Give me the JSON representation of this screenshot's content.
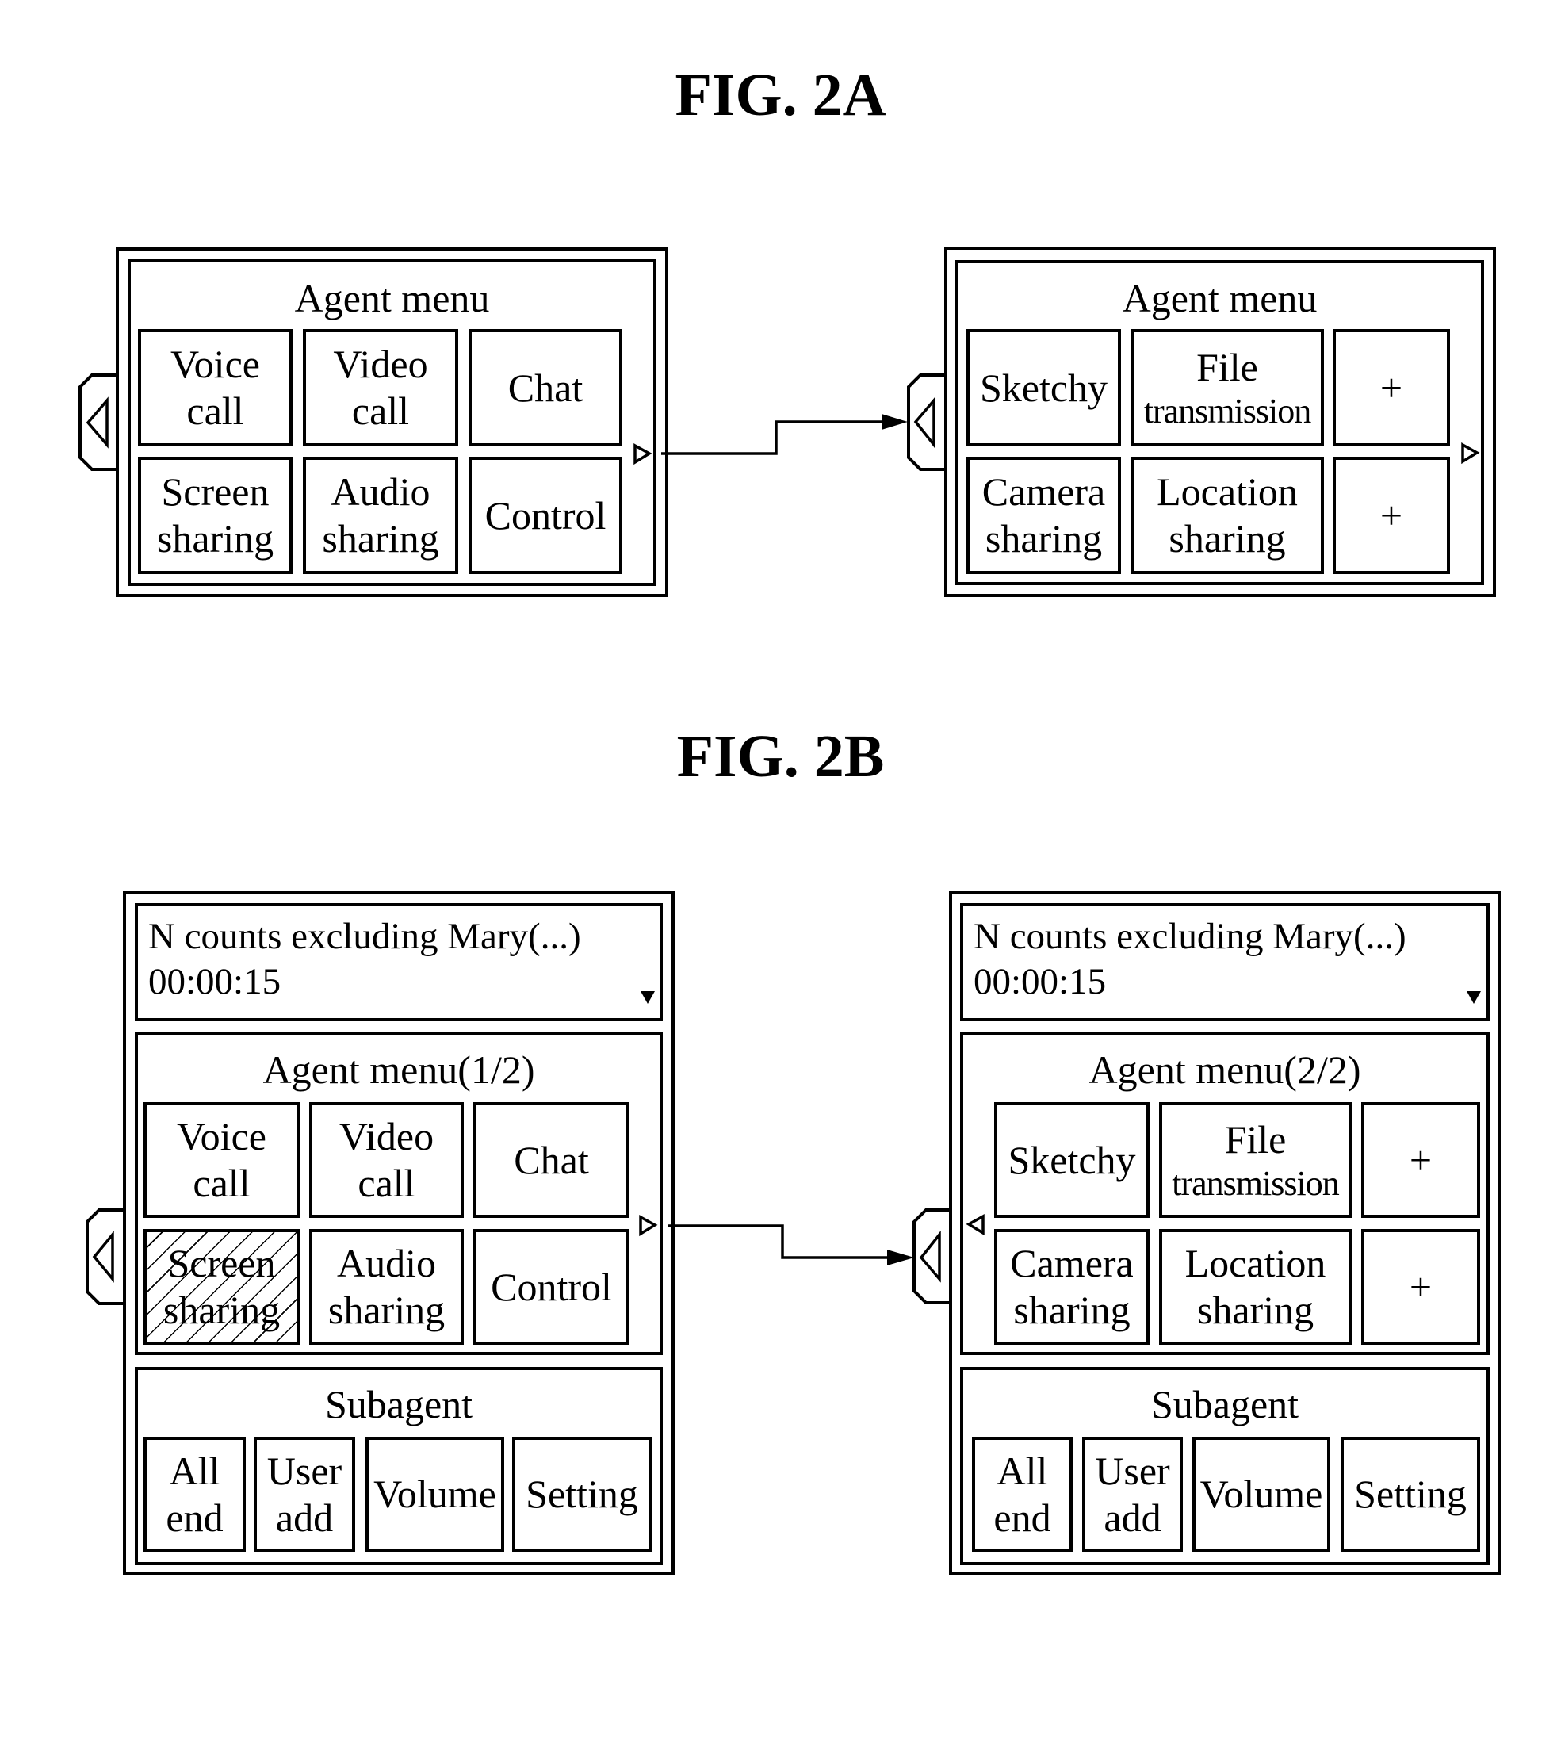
{
  "figures": {
    "fig2a": {
      "title": "FIG. 2A",
      "left_panel": {
        "section_title": "Agent menu",
        "items": [
          [
            "Voice",
            "call"
          ],
          [
            "Video",
            "call"
          ],
          [
            "Chat"
          ],
          [
            "Screen",
            "sharing"
          ],
          [
            "Audio",
            "sharing"
          ],
          [
            "Control"
          ]
        ]
      },
      "right_panel": {
        "section_title": "Agent menu",
        "items": [
          [
            "Sketchy"
          ],
          [
            "File",
            "transmission"
          ],
          [
            "+"
          ],
          [
            "Camera",
            "sharing"
          ],
          [
            "Location",
            "sharing"
          ],
          [
            "+"
          ]
        ]
      }
    },
    "fig2b": {
      "title": "FIG. 2B",
      "left_panel": {
        "header_line1": "N counts excluding Mary(...)",
        "header_line2": "00:00:15",
        "agent_title": "Agent menu(1/2)",
        "agent_items": [
          [
            "Voice",
            "call"
          ],
          [
            "Video",
            "call"
          ],
          [
            "Chat"
          ],
          [
            "Screen",
            "sharing"
          ],
          [
            "Audio",
            "sharing"
          ],
          [
            "Control"
          ]
        ],
        "selected_item": "Screen sharing",
        "subagent_title": "Subagent",
        "subagent_items": [
          [
            "All",
            "end"
          ],
          [
            "User",
            "add"
          ],
          [
            "Volume"
          ],
          [
            "Setting"
          ]
        ]
      },
      "right_panel": {
        "header_line1": "N counts excluding Mary(...)",
        "header_line2": "00:00:15",
        "agent_title": "Agent menu(2/2)",
        "agent_items": [
          [
            "Sketchy"
          ],
          [
            "File",
            "transmission"
          ],
          [
            "+"
          ],
          [
            "Camera",
            "sharing"
          ],
          [
            "Location",
            "sharing"
          ],
          [
            "+"
          ]
        ],
        "subagent_title": "Subagent",
        "subagent_items": [
          [
            "All",
            "end"
          ],
          [
            "User",
            "add"
          ],
          [
            "Volume"
          ],
          [
            "Setting"
          ]
        ]
      }
    }
  },
  "icons": {
    "collapse_tab": "left-triangle-tab",
    "next_page": "right-small-triangle",
    "prev_page": "left-small-triangle",
    "header_dropdown": "down-filled-triangle",
    "connector": "right-arrow"
  }
}
